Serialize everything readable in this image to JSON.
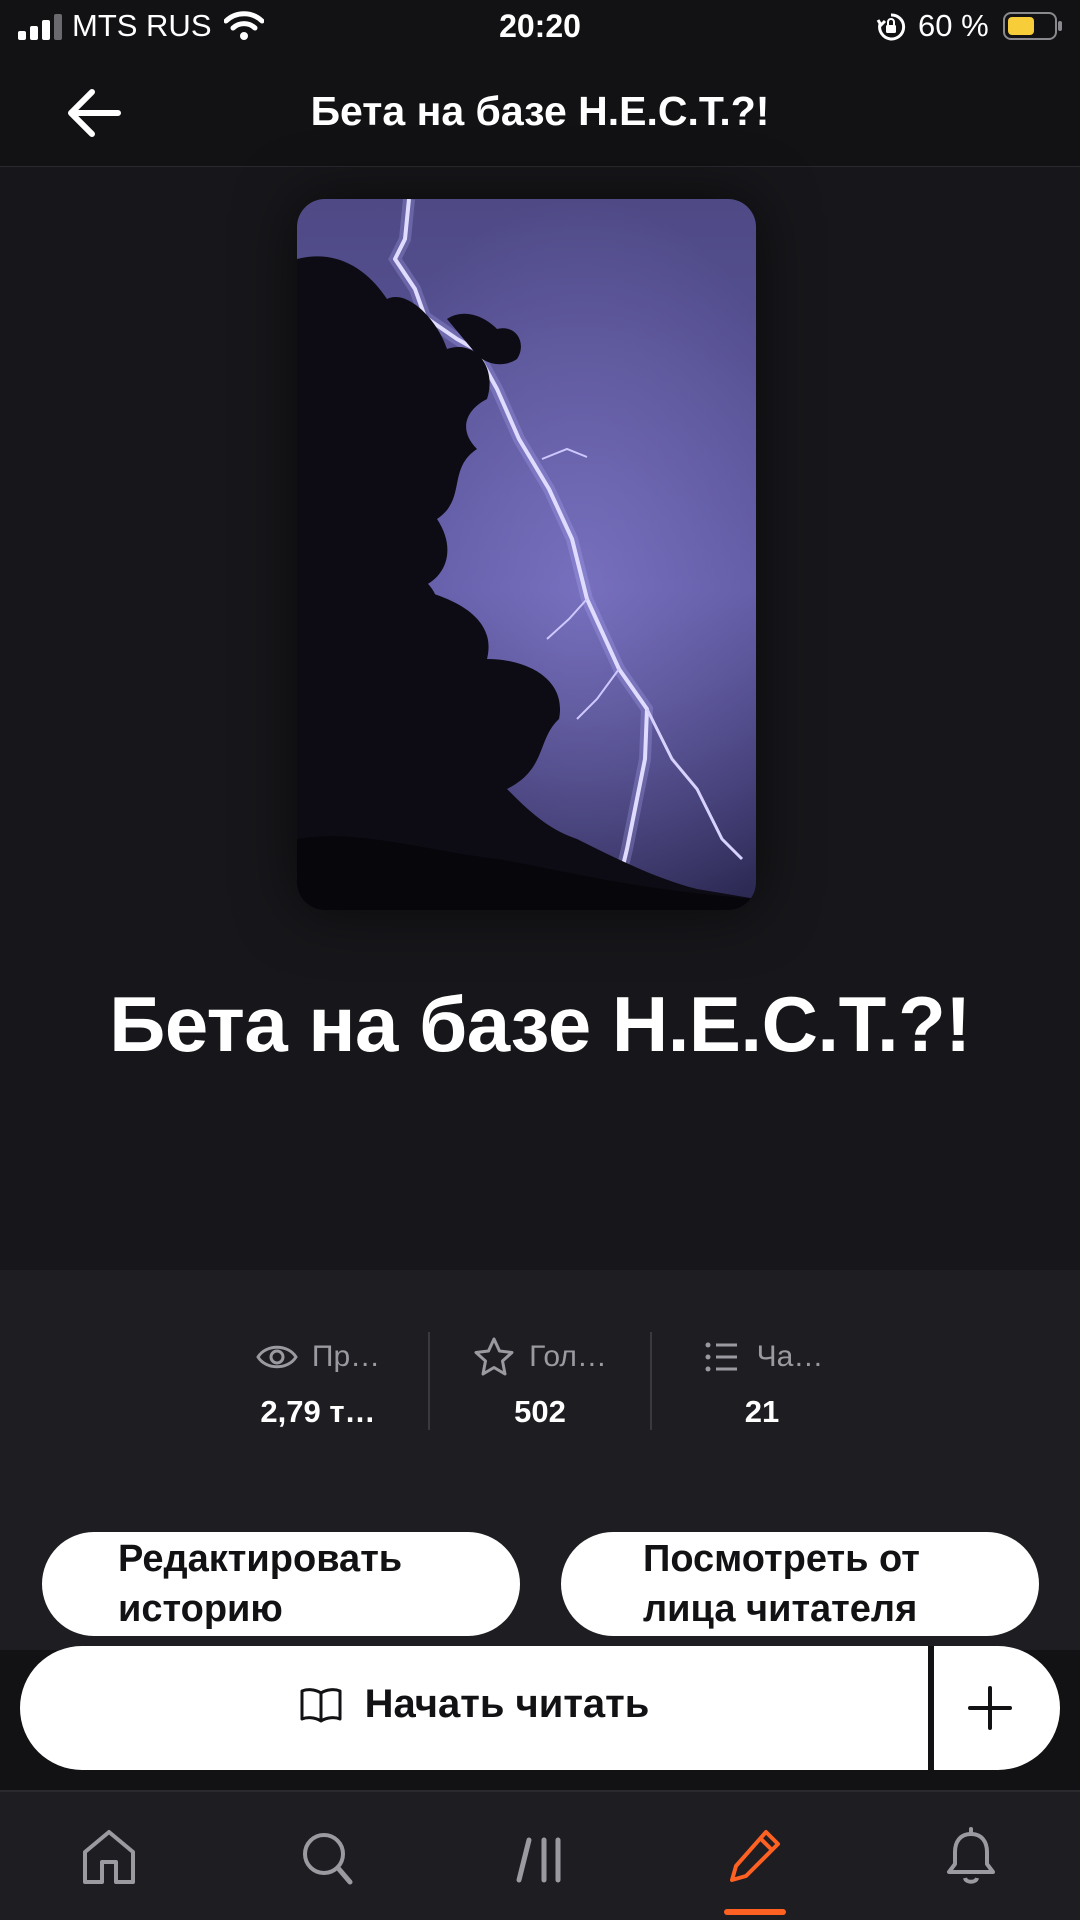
{
  "status_bar": {
    "carrier": "MTS RUS",
    "time": "20:20",
    "battery_percent": "60 %",
    "battery_level": 0.6,
    "icons": [
      "signal-icon",
      "wifi-icon",
      "orientation-lock-icon",
      "battery-icon"
    ]
  },
  "header": {
    "title": "Бета на базе Н.Е.С.Т.?!",
    "back_icon": "arrow-left-icon"
  },
  "story": {
    "title": "Бета на базе Н.Е.С.Т.?!",
    "cover": "lightning-night-sky-with-tree-silhouette"
  },
  "stats": [
    {
      "icon": "eye-icon",
      "label": "Пр…",
      "value": "2,79 т…"
    },
    {
      "icon": "star-icon",
      "label": "Гол…",
      "value": "502"
    },
    {
      "icon": "list-icon",
      "label": "Ча…",
      "value": "21"
    }
  ],
  "actions": {
    "edit_line1": "Редактировать",
    "edit_line2": "историю",
    "preview_line1": "Посмотреть от",
    "preview_line2": "лица читателя",
    "read_label": "Начать читать",
    "read_icon": "open-book-icon",
    "add_icon": "plus-icon"
  },
  "tab_bar": {
    "tabs": [
      "home-icon",
      "search-icon",
      "library-icon",
      "write-pencil-icon",
      "bell-icon"
    ],
    "active_tab": "write-pencil-icon"
  },
  "colors": {
    "background": "#121114",
    "panel": "#1e1d22",
    "accent": "#ff6122",
    "battery": "#f7cd3a"
  }
}
